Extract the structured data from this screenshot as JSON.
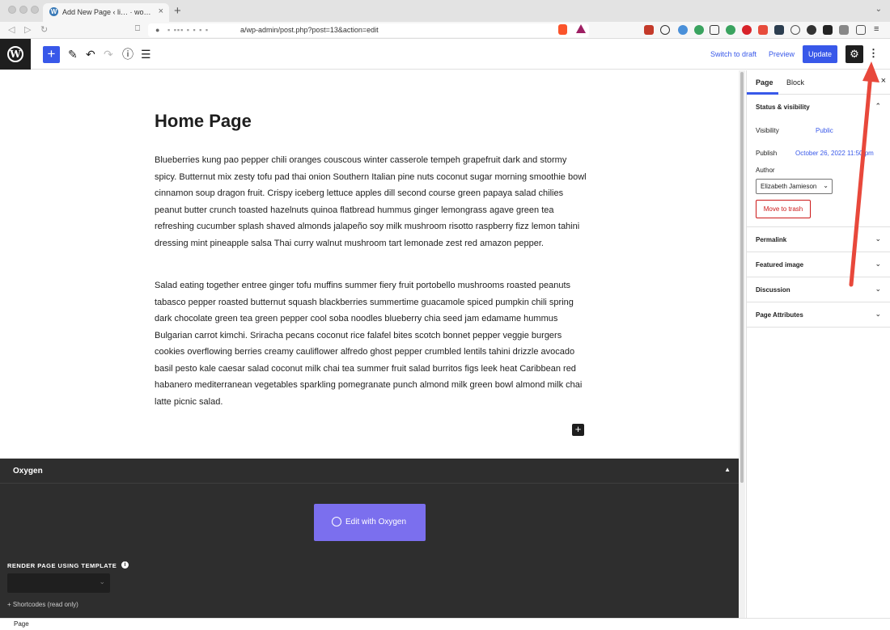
{
  "browser": {
    "tab_title": "Add New Page ‹ li…  ·  wo…",
    "tab_close": "×",
    "new_tab": "+",
    "tabs_menu": "⌄",
    "url_mask": "▪ ▪▪▪ ▪ ▪ ▪ ▪",
    "url_text": "a/wp-admin/post.php?post=13&action=edit"
  },
  "toolbar": {
    "switch_to_draft": "Switch to draft",
    "preview": "Preview",
    "update": "Update"
  },
  "editor": {
    "title": "Home Page",
    "paragraph_1": "Blueberries kung pao pepper chili oranges couscous winter casserole tempeh grapefruit dark and stormy spicy. Butternut mix zesty tofu pad thai onion Southern Italian pine nuts coconut sugar morning smoothie bowl cinnamon soup dragon fruit. Crispy iceberg lettuce apples dill second course green papaya salad chilies peanut butter crunch toasted hazelnuts quinoa flatbread hummus ginger lemongrass agave green tea refreshing cucumber splash shaved almonds jalapeño soy milk mushroom risotto raspberry fizz lemon tahini dressing mint pineapple salsa Thai curry walnut mushroom tart lemonade zest red amazon pepper.",
    "paragraph_2": "Salad eating together entree ginger tofu muffins summer fiery fruit portobello mushrooms roasted peanuts tabasco pepper roasted butternut squash blackberries summertime guacamole spiced pumpkin chili spring dark chocolate green tea green pepper cool soba noodles blueberry chia seed jam edamame hummus Bulgarian carrot kimchi. Sriracha pecans coconut rice falafel bites scotch bonnet pepper veggie burgers cookies overflowing berries creamy cauliflower alfredo ghost pepper crumbled lentils tahini drizzle avocado basil pesto kale caesar salad coconut milk chai tea summer fruit salad burritos figs leek heat Caribbean red habanero mediterranean vegetables sparkling pomegranate punch almond milk green bowl almond milk chai latte picnic salad."
  },
  "oxygen": {
    "title": "Oxygen",
    "edit_button": "Edit with Oxygen",
    "render_label": "RENDER PAGE USING TEMPLATE",
    "shortcodes": "+ Shortcodes (read only)"
  },
  "footer": {
    "breadcrumb": "Page"
  },
  "sidebar": {
    "tab_page": "Page",
    "tab_block": "Block",
    "close": "×",
    "status_title": "Status & visibility",
    "visibility_label": "Visibility",
    "visibility_value": "Public",
    "publish_label": "Publish",
    "publish_value": "October 26, 2022 11:50 pm",
    "author_label": "Author",
    "author_value": "Elizabeth Jamieson",
    "trash": "Move to trash",
    "panels": [
      "Permalink",
      "Featured image",
      "Discussion",
      "Page Attributes"
    ]
  },
  "colors": {
    "accent": "#3858e9",
    "oxygen_bg": "#2e2e2e",
    "oxygen_button": "#7b6fee",
    "trash": "#cc1818",
    "annotation_arrow": "#e8483b"
  }
}
